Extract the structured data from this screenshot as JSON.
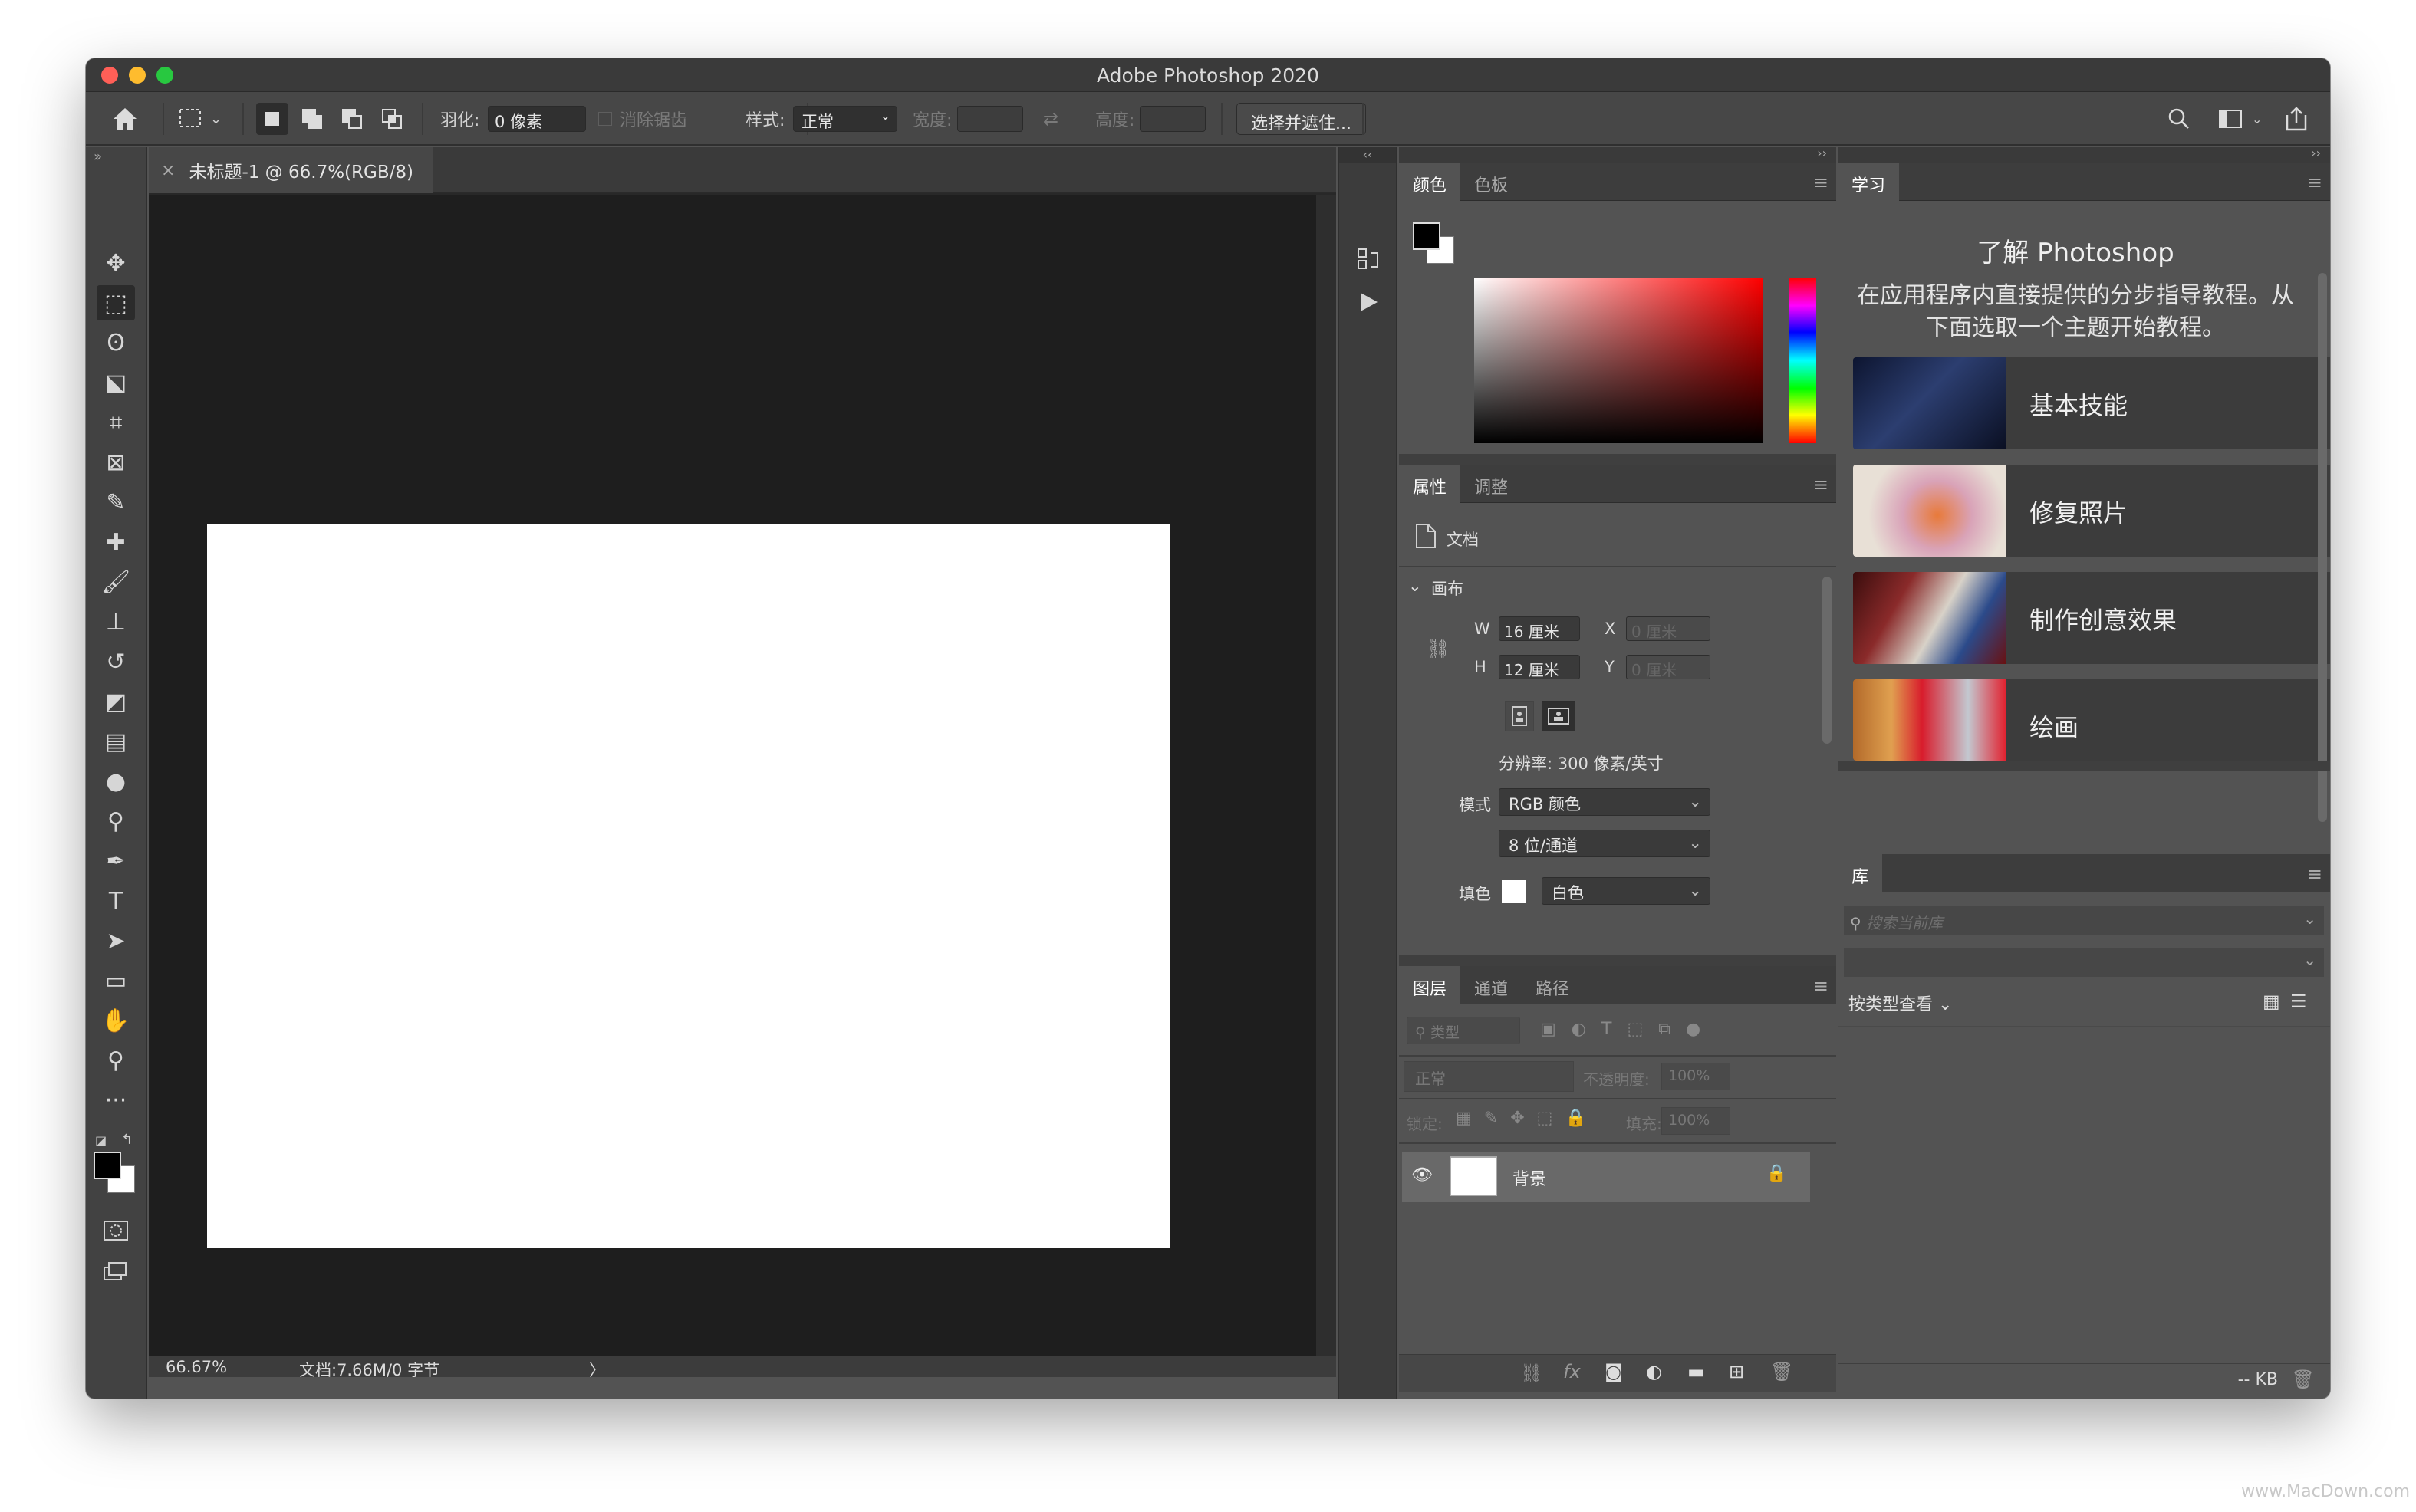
{
  "window": {
    "title": "Adobe Photoshop 2020"
  },
  "options_bar": {
    "feather_label": "羽化:",
    "feather_value": "0 像素",
    "antialias_label": "消除锯齿",
    "style_label": "样式:",
    "style_value": "正常",
    "width_label": "宽度:",
    "height_label": "高度:",
    "select_mask_button": "选择并遮住..."
  },
  "tools": [
    {
      "name": "move-tool",
      "glyph": "✥"
    },
    {
      "name": "marquee-tool",
      "glyph": "⬚"
    },
    {
      "name": "lasso-tool",
      "glyph": "ʘ"
    },
    {
      "name": "object-select-tool",
      "glyph": "⬕"
    },
    {
      "name": "crop-tool",
      "glyph": "⌗"
    },
    {
      "name": "frame-tool",
      "glyph": "⊠"
    },
    {
      "name": "eyedropper-tool",
      "glyph": "✎"
    },
    {
      "name": "healing-tool",
      "glyph": "✚"
    },
    {
      "name": "brush-tool",
      "glyph": "🖌"
    },
    {
      "name": "stamp-tool",
      "glyph": "⊥"
    },
    {
      "name": "history-brush-tool",
      "glyph": "↺"
    },
    {
      "name": "eraser-tool",
      "glyph": "◩"
    },
    {
      "name": "gradient-tool",
      "glyph": "▤"
    },
    {
      "name": "blur-tool",
      "glyph": "●"
    },
    {
      "name": "dodge-tool",
      "glyph": "⚲"
    },
    {
      "name": "pen-tool",
      "glyph": "✒"
    },
    {
      "name": "type-tool",
      "glyph": "T"
    },
    {
      "name": "path-select-tool",
      "glyph": "➤"
    },
    {
      "name": "rectangle-tool",
      "glyph": "▭"
    },
    {
      "name": "hand-tool",
      "glyph": "✋"
    },
    {
      "name": "zoom-tool",
      "glyph": "⚲"
    },
    {
      "name": "more-tools",
      "glyph": "···"
    }
  ],
  "document": {
    "tab_title": "未标题-1 @ 66.7%(RGB/8)",
    "zoom": "66.67%",
    "doc_info": "文档:7.66M/0 字节",
    "status_arrow": "〉"
  },
  "color_panel": {
    "tab_color": "颜色",
    "tab_swatches": "色板",
    "hue": "#ff0000",
    "foreground": "#000000",
    "background": "#ffffff"
  },
  "properties_panel": {
    "tab_properties": "属性",
    "tab_adjustments": "调整",
    "doc_label": "文档",
    "canvas_label": "画布",
    "w_label": "W",
    "w_value": "16 厘米",
    "h_label": "H",
    "h_value": "12 厘米",
    "x_label": "X",
    "x_value": "0 厘米",
    "y_label": "Y",
    "y_value": "0 厘米",
    "resolution": "分辨率: 300 像素/英寸",
    "mode_label": "模式",
    "mode_value": "RGB 颜色",
    "depth_value": "8 位/通道",
    "fill_label": "填色",
    "fill_value": "白色"
  },
  "layers_panel": {
    "tab_layers": "图层",
    "tab_channels": "通道",
    "tab_paths": "路径",
    "filter_placeholder": "类型",
    "blend_mode": "正常",
    "opacity_label": "不透明度:",
    "opacity_value": "100%",
    "lock_label": "锁定:",
    "fill_label": "填充:",
    "fill_value": "100%",
    "layers": [
      {
        "name": "背景",
        "visible": true,
        "locked": true
      }
    ]
  },
  "learn_panel": {
    "tab": "学习",
    "heading": "了解 Photoshop",
    "description_line1": "在应用程序内直接提供的分步指导教程。从",
    "description_line2": "下面选取一个主题开始教程。",
    "topics": [
      {
        "label": "基本技能"
      },
      {
        "label": "修复照片"
      },
      {
        "label": "制作创意效果"
      },
      {
        "label": "绘画"
      }
    ]
  },
  "library_panel": {
    "tab": "库",
    "search_placeholder": "搜索当前库",
    "view_by": "按类型查看",
    "size": "-- KB"
  },
  "watermark": "www.MacDown.com"
}
